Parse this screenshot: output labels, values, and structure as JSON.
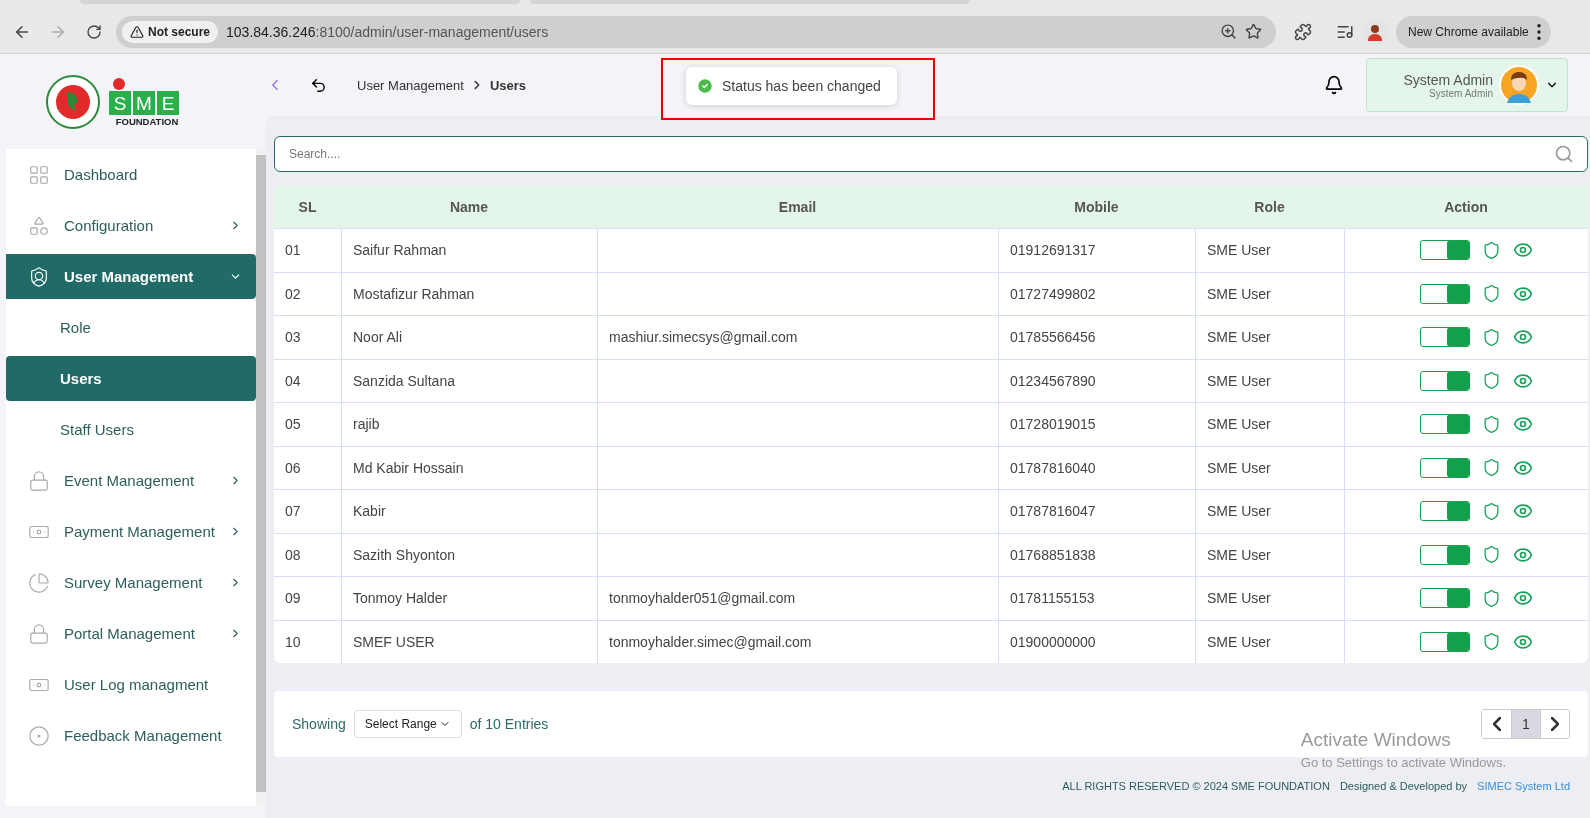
{
  "browser": {
    "security": "Not secure",
    "url_host": "103.84.36.246",
    "url_rest": ":8100/admin/user-management/users",
    "update_label": "New Chrome available"
  },
  "logo": {
    "name": "FOUNDATION",
    "mark_letters": [
      "S",
      "M",
      "E"
    ]
  },
  "sidebar": {
    "items": [
      {
        "label": "Dashboard",
        "kind": "link",
        "selected": false
      },
      {
        "label": "Configuration",
        "kind": "submenu",
        "expanded": false,
        "selected": false
      },
      {
        "label": "User Management",
        "kind": "submenu",
        "expanded": true,
        "selected": true,
        "children": [
          {
            "label": "Role",
            "selected": false
          },
          {
            "label": "Users",
            "selected": true
          },
          {
            "label": "Staff Users",
            "selected": false
          }
        ]
      },
      {
        "label": "Event Management",
        "kind": "submenu",
        "expanded": false,
        "selected": false
      },
      {
        "label": "Payment Management",
        "kind": "submenu",
        "expanded": false,
        "selected": false
      },
      {
        "label": "Survey Management",
        "kind": "submenu",
        "expanded": false,
        "selected": false
      },
      {
        "label": "Portal Management",
        "kind": "submenu",
        "expanded": false,
        "selected": false
      },
      {
        "label": "User Log managment",
        "kind": "link",
        "selected": false
      },
      {
        "label": "Feedback Management",
        "kind": "link",
        "selected": false
      }
    ]
  },
  "breadcrumb": {
    "parent": "User Management",
    "current": "Users"
  },
  "toast": {
    "message": "Status has been changed",
    "highlighted": true
  },
  "user": {
    "name": "System Admin",
    "role": "System Admin"
  },
  "search": {
    "placeholder": "Search...."
  },
  "table": {
    "columns": [
      "SL",
      "Name",
      "Email",
      "Mobile",
      "Role",
      "Action"
    ],
    "rows": [
      {
        "sl": "01",
        "name": "Saifur Rahman",
        "email": "",
        "mobile": "01912691317",
        "role": "SME User",
        "active": true
      },
      {
        "sl": "02",
        "name": "Mostafizur Rahman",
        "email": "",
        "mobile": "01727499802",
        "role": "SME User",
        "active": true
      },
      {
        "sl": "03",
        "name": "Noor Ali",
        "email": "mashiur.simecsys@gmail.com",
        "mobile": "01785566456",
        "role": "SME User",
        "active": true
      },
      {
        "sl": "04",
        "name": "Sanzida Sultana",
        "email": "",
        "mobile": "01234567890",
        "role": "SME User",
        "active": true
      },
      {
        "sl": "05",
        "name": "rajib",
        "email": "",
        "mobile": "01728019015",
        "role": "SME User",
        "active": true
      },
      {
        "sl": "06",
        "name": "Md Kabir Hossain",
        "email": "",
        "mobile": "01787816040",
        "role": "SME User",
        "active": true
      },
      {
        "sl": "07",
        "name": "Kabir",
        "email": "",
        "mobile": "01787816047",
        "role": "SME User",
        "active": true
      },
      {
        "sl": "08",
        "name": "Sazith Shyonton",
        "email": "",
        "mobile": "01768851838",
        "role": "SME User",
        "active": true
      },
      {
        "sl": "09",
        "name": "Tonmoy Halder",
        "email": "tonmoyhalder051@gmail.com",
        "mobile": "01781155153",
        "role": "SME User",
        "active": true
      },
      {
        "sl": "10",
        "name": "SMEF USER",
        "email": "tonmoyhalder.simec@gmail.com",
        "mobile": "01900000000",
        "role": "SME User",
        "active": true
      }
    ]
  },
  "pagination": {
    "showing": "Showing",
    "range": "Select Range",
    "entries": "of 10 Entries",
    "pages": [
      {
        "label": "1",
        "selected": true
      }
    ]
  },
  "os_notice": {
    "title": "Activate Windows",
    "text": "Go to Settings to activate Windows."
  },
  "footer": {
    "rights": "ALL RIGHTS RESERVED © 2024 SME FOUNDATION",
    "designed": "Designed & Developed by",
    "company": "SIMEC System Ltd"
  }
}
